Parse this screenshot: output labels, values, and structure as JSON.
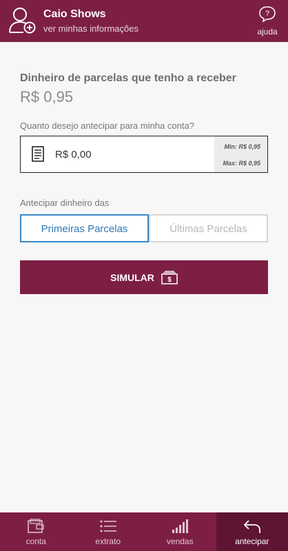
{
  "header": {
    "user_name": "Caio Shows",
    "subtitle": "ver minhas informações",
    "help_label": "ajuda"
  },
  "receivables": {
    "title": "Dinheiro de parcelas que tenho a receber",
    "balance": "R$ 0,95"
  },
  "advance": {
    "question": "Quanto desejo antecipar para minha conta?",
    "amount_value": "R$ 0,00",
    "min_label": "Min: R$ 0,95",
    "max_label": "Max: R$ 0,95"
  },
  "installments": {
    "label": "Antecipar dinheiro das",
    "first_option": "Primeiras Parcelas",
    "last_option": "Últimas Parcelas",
    "selected": "Primeiras Parcelas"
  },
  "simulate_button": "SIMULAR",
  "bottom_nav": [
    {
      "label": "conta",
      "icon": "wallet-icon"
    },
    {
      "label": "extrato",
      "icon": "list-icon"
    },
    {
      "label": "vendas",
      "icon": "bars-icon"
    },
    {
      "label": "antecipar",
      "icon": "undo-arrow-icon",
      "active": true
    }
  ],
  "colors": {
    "brand": "#7d1f45",
    "brand_dark": "#5e1532",
    "selected_border": "#3b86c6"
  }
}
